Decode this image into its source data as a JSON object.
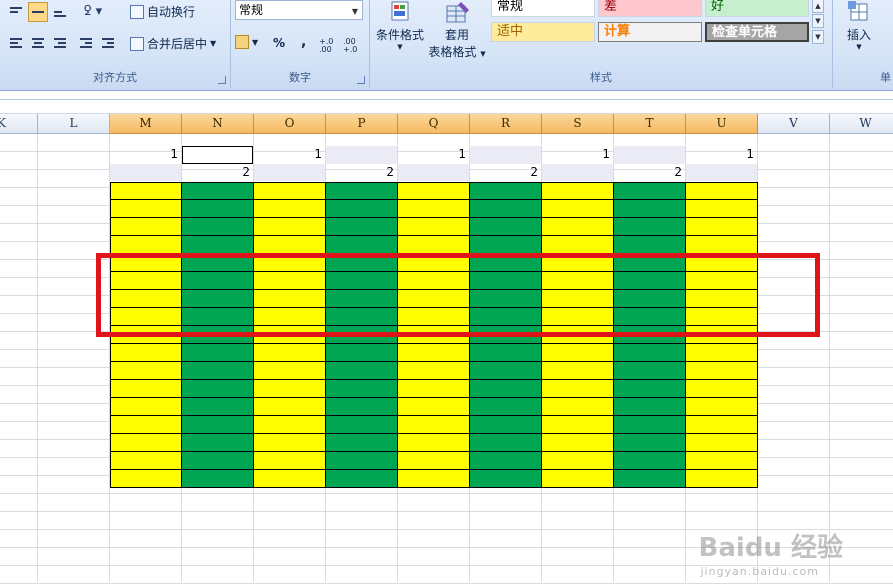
{
  "ribbon": {
    "alignment": {
      "group_label": "对齐方式",
      "wrap_text": "自动换行",
      "merge_center": "合并后居中"
    },
    "number": {
      "group_label": "数字",
      "format_value": "常规",
      "percent_symbol": "%",
      "comma_symbol": ",",
      "increase_decimal": "+.0 .00",
      "decrease_decimal": ".00 +.0"
    },
    "styles": {
      "group_label": "样式",
      "conditional_format": "条件格式",
      "table_format_line1": "套用",
      "table_format_line2": "表格格式",
      "cells": [
        {
          "label": "常规",
          "bg": "#ffffff",
          "fg": "#000000"
        },
        {
          "label": "差",
          "bg": "#ffc7ce",
          "fg": "#9c0006"
        },
        {
          "label": "好",
          "bg": "#c6efce",
          "fg": "#006100"
        },
        {
          "label": "适中",
          "bg": "#ffeb9c",
          "fg": "#9c6500"
        },
        {
          "label": "计算",
          "bg": "#f2f2f2",
          "fg": "#fa7d00"
        },
        {
          "label": "检查单元格",
          "bg": "#a5a5a5",
          "fg": "#ffffff"
        }
      ]
    },
    "cells_group": {
      "group_label": "单",
      "insert": "插入"
    }
  },
  "sheet": {
    "columns": [
      "K",
      "L",
      "M",
      "N",
      "O",
      "P",
      "Q",
      "R",
      "S",
      "T",
      "U",
      "V",
      "W"
    ],
    "selected_columns": [
      "M",
      "N",
      "O",
      "P",
      "Q",
      "R",
      "S",
      "T",
      "U"
    ],
    "row1_values": [
      "1",
      "",
      "1",
      "",
      "1",
      "",
      "1",
      "",
      "1"
    ],
    "row2_values": [
      "",
      "2",
      "",
      "2",
      "",
      "2",
      "",
      "2",
      ""
    ],
    "fill_pattern": [
      "yellow",
      "green",
      "yellow",
      "green",
      "yellow",
      "green",
      "yellow",
      "green",
      "yellow"
    ],
    "fill_rows": 17,
    "colors": {
      "yellow": "#ffff00",
      "green": "#00a651",
      "highlight": "#e0151b"
    }
  },
  "watermark": {
    "brand": "Baidu 经验",
    "url": "jingyan.baidu.com"
  }
}
